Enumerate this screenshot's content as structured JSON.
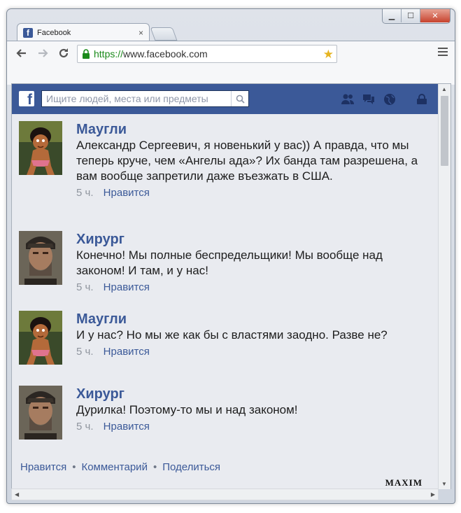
{
  "browser": {
    "tab_title": "Facebook",
    "tab_close": "×",
    "url_scheme": "https://",
    "url_host": "www.facebook.com",
    "window_controls": {
      "minimize": "▁",
      "maximize": "☐",
      "close": "✕"
    }
  },
  "facebook": {
    "logo": "f",
    "search_placeholder": "Ищите людей, места или предметы"
  },
  "comments": [
    {
      "author": "Маугли",
      "text": "Александр Сергеевич, я новенький у вас)) А правда, что мы теперь круче, чем «Ангелы ада»? Их банда там разрешена, а вам вообще запретили даже въезжать в США.",
      "time": "5 ч.",
      "like": "Нравится",
      "avatar": "mowgli-avatar"
    },
    {
      "author": "Хирург",
      "text": "Конечно! Мы полные беспредельщики! Мы вообще над законом! И там, и у нас!",
      "time": "5 ч.",
      "like": "Нравится",
      "avatar": "surgeon-avatar"
    },
    {
      "author": "Маугли",
      "text": "И у нас? Но мы же как бы с властями заодно. Разве не?",
      "time": "5 ч.",
      "like": "Нравится",
      "avatar": "mowgli-avatar"
    },
    {
      "author": "Хирург",
      "text": "Дурилка! Поэтому-то мы и над законом!",
      "time": "5 ч.",
      "like": "Нравится",
      "avatar": "surgeon-avatar"
    }
  ],
  "actions": {
    "like": "Нравится",
    "comment": "Комментарий",
    "share": "Поделиться",
    "separator": "•"
  },
  "watermark": "MAXIM",
  "colors": {
    "facebook_blue": "#3b5998",
    "feed_bg": "#e9ebf0",
    "https_green": "#1a8a1a"
  }
}
